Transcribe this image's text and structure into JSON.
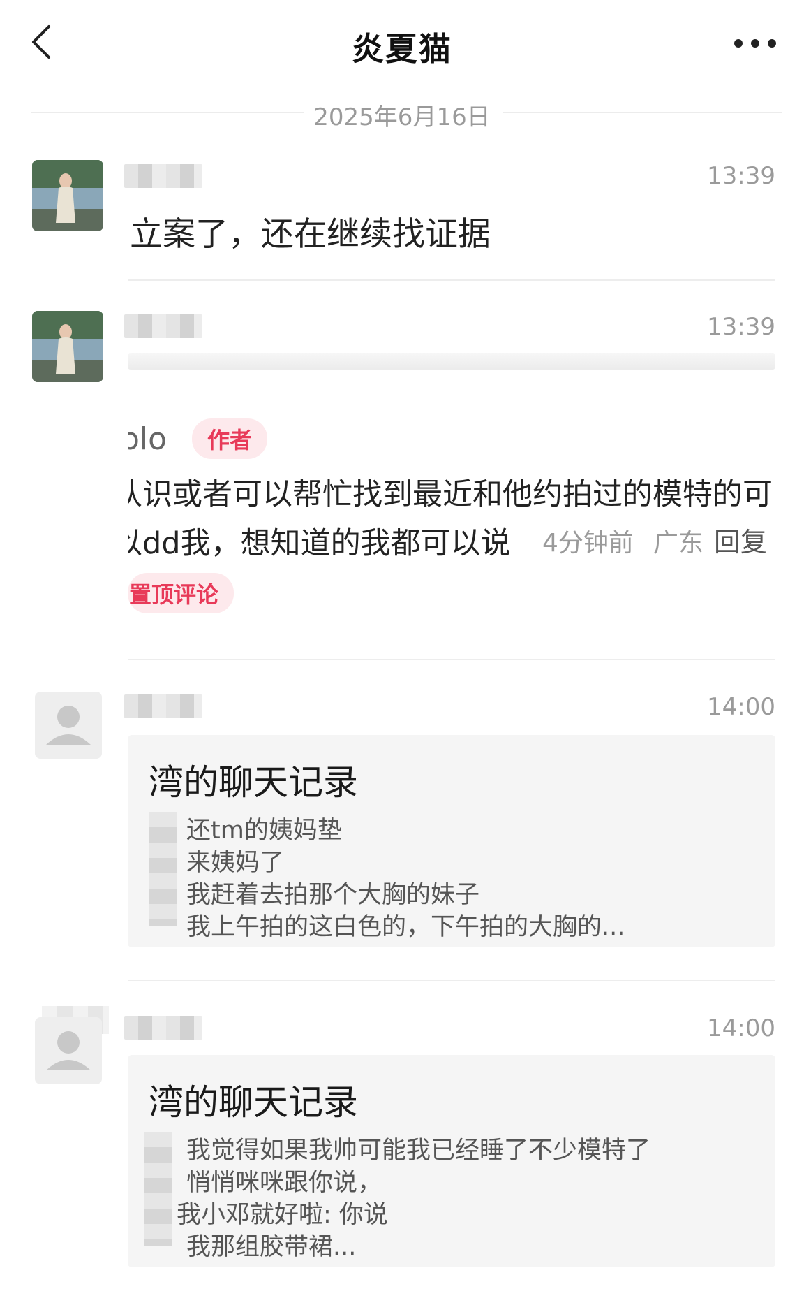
{
  "header": {
    "title": "炎夏猫"
  },
  "date_divider": "2025年6月16日",
  "messages": [
    {
      "time": "13:39",
      "text": "立案了，还在继续找证据"
    },
    {
      "time": "13:39",
      "comment_screenshot": {
        "username_fragment": "olo",
        "author_tag": "作者",
        "line1": "认识或者可以帮忙找到最近和他约拍过的模特的可",
        "line2": "以dd我，想知道的我都可以说",
        "meta_time": "4分钟前",
        "meta_region": "广东",
        "reply": "回复",
        "pinned_tag": "置顶评论"
      }
    },
    {
      "time": "14:00",
      "card": {
        "title": "湾的聊天记录",
        "lines": [
          "还tm的姨妈垫",
          "来姨妈了",
          "我赶着去拍那个大胸的妹子",
          "我上午拍的这白色的，下午拍的大胸的..."
        ]
      }
    },
    {
      "time": "14:00",
      "card": {
        "title": "湾的聊天记录",
        "lines": [
          "我觉得如果我帅可能我已经睡了不少模特了",
          "悄悄咪咪跟你说，",
          "我小邓就好啦: 你说",
          "我那组胶带裙..."
        ]
      }
    }
  ]
}
